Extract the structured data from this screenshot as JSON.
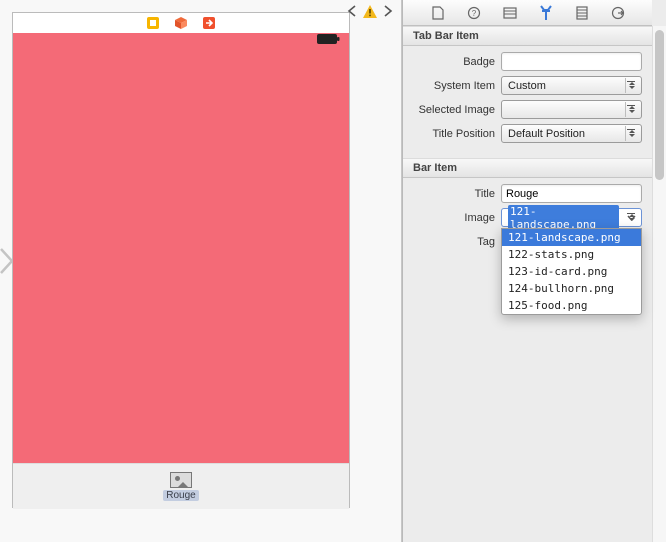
{
  "canvas": {
    "tabitem_label": "Rouge"
  },
  "inspector": {
    "section1": "Tab Bar Item",
    "section2": "Bar Item",
    "badge_label": "Badge",
    "badge_value": "",
    "system_item_label": "System Item",
    "system_item_value": "Custom",
    "selected_image_label": "Selected Image",
    "selected_image_value": "",
    "title_position_label": "Title Position",
    "title_position_value": "Default Position",
    "title_label": "Title",
    "title_value": "Rouge",
    "image_label": "Image",
    "image_value": "121-landscape.png",
    "tag_label": "Tag",
    "image_options": [
      "121-landscape.png",
      "122-stats.png",
      "123-id-card.png",
      "124-bullhorn.png",
      "125-food.png"
    ]
  }
}
